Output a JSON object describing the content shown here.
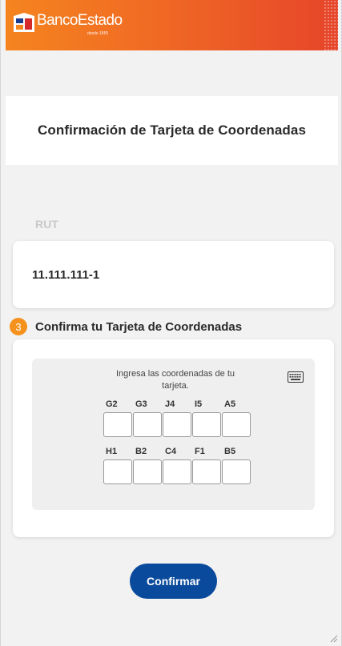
{
  "header": {
    "brand_name": "BancoEstado",
    "brand_tagline": "desde 1855"
  },
  "page": {
    "title": "Confirmación de Tarjeta de Coordenadas"
  },
  "rut": {
    "label": "RUT",
    "value": "11.111.111-1"
  },
  "step": {
    "number": "3",
    "title": "Confirma tu Tarjeta de Coordenadas"
  },
  "coordinates": {
    "instruction": "Ingresa las coordenadas de tu tarjeta.",
    "row1": [
      {
        "label": "G2",
        "value": ""
      },
      {
        "label": "G3",
        "value": ""
      },
      {
        "label": "J4",
        "value": ""
      },
      {
        "label": "I5",
        "value": ""
      },
      {
        "label": "A5",
        "value": ""
      }
    ],
    "row2": [
      {
        "label": "H1",
        "value": ""
      },
      {
        "label": "B2",
        "value": ""
      },
      {
        "label": "C4",
        "value": ""
      },
      {
        "label": "F1",
        "value": ""
      },
      {
        "label": "B5",
        "value": ""
      }
    ]
  },
  "actions": {
    "confirm_label": "Confirmar"
  },
  "colors": {
    "header_start": "#f5841f",
    "header_end": "#e6452a",
    "primary_button": "#0a4a9c",
    "step_badge": "#f5921e"
  },
  "icons": {
    "keyboard": "keyboard-icon",
    "logo": "bancoestado-logo-icon"
  }
}
